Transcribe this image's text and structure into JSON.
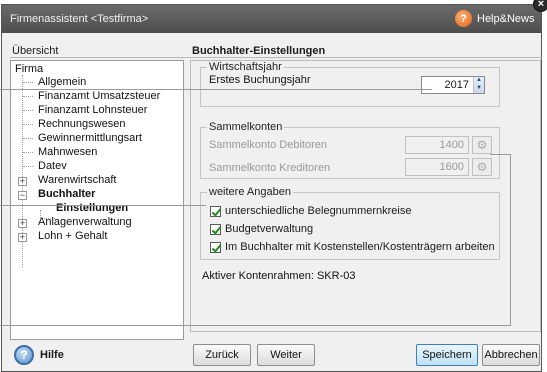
{
  "window": {
    "title": "Firmenassistent <Testfirma>",
    "help_news": "Help&News",
    "close_glyph": "×"
  },
  "headers": {
    "left": "Übersicht",
    "right": "Buchhalter-Einstellungen"
  },
  "tree": {
    "root": "Firma",
    "items": [
      {
        "label": "Allgemein"
      },
      {
        "label": "Finanzamt Umsatzsteuer"
      },
      {
        "label": "Finanzamt Lohnsteuer"
      },
      {
        "label": "Rechnungswesen"
      },
      {
        "label": "Gewinnermittlungsart"
      },
      {
        "label": "Mahnwesen"
      },
      {
        "label": "Datev"
      },
      {
        "label": "Warenwirtschaft"
      },
      {
        "label": "Buchhalter"
      },
      {
        "label": "Einstellungen"
      },
      {
        "label": "Anlagenverwaltung"
      },
      {
        "label": "Lohn + Gehalt"
      }
    ]
  },
  "wirtschaftsjahr": {
    "title": "Wirtschaftsjahr",
    "label": "Erstes Buchungsjahr",
    "value": "2017"
  },
  "sammelkonten": {
    "title": "Sammelkonten",
    "debitoren_label": "Sammelkonto Debitoren",
    "debitoren_value": "1400",
    "kreditoren_label": "Sammelkonto Kreditoren",
    "kreditoren_value": "1600"
  },
  "weitere": {
    "title": "weitere Angaben",
    "options": [
      {
        "label": "unterschiedliche Belegnummernkreise",
        "checked": true
      },
      {
        "label": "Budgetverwaltung",
        "checked": true
      },
      {
        "label": "Im Buchhalter mit Kostenstellen/Kostenträgern arbeiten",
        "checked": true
      }
    ]
  },
  "kontenrahmen": "Aktiver Kontenrahmen: SKR-03",
  "buttons": {
    "hilfe": "Hilfe",
    "zurueck": "Zurück",
    "weiter": "Weiter",
    "speichern": "Speichern",
    "abbrechen": "Abbrechen"
  },
  "icons": {
    "help": "question-mark-icon",
    "gear": "gear-icon",
    "spin_up": "▲",
    "spin_down": "▼",
    "gear_glyph": "⚙",
    "q_glyph": "?",
    "plus": "+",
    "minus": "−"
  },
  "colors": {
    "titlebar": "#5a5a5a",
    "help_orange": "#e0601a",
    "check_green": "#1c8a1c",
    "primary_button": "#3c7fb1"
  }
}
